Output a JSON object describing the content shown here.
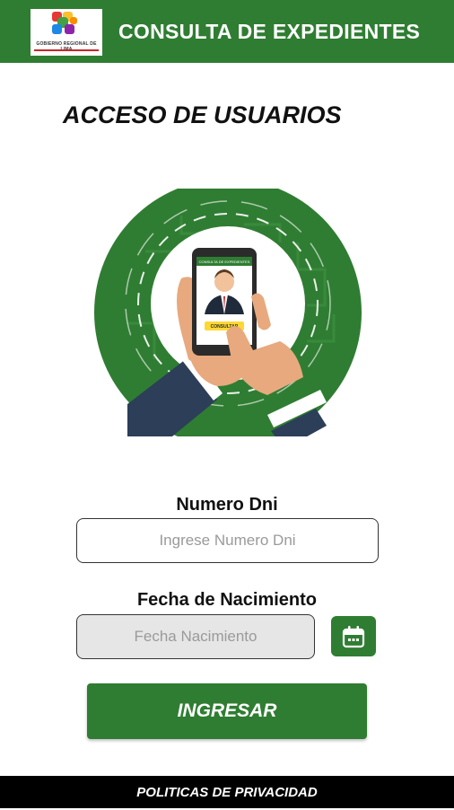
{
  "header": {
    "title": "CONSULTA DE EXPEDIENTES",
    "logo_caption": "GOBIERNO REGIONAL DE LIMA",
    "color": "#2f7d32"
  },
  "page_title": "ACCESO DE USUARIOS",
  "hero": {
    "phone_header_text": "CONSULTA DE EXPEDIENTES",
    "phone_button_text": "CONSULTAR"
  },
  "form": {
    "dni_label": "Numero Dni",
    "dni_placeholder": "Ingrese Numero Dni",
    "fecha_label": "Fecha de Nacimiento",
    "fecha_placeholder": "Fecha Nacimiento",
    "calendar_icon": "calendar-icon",
    "submit_label": "INGRESAR"
  },
  "footer": {
    "privacy_label": "POLITICAS DE PRIVACIDAD"
  },
  "colors": {
    "primary_green": "#2f7d32",
    "footer_bg": "#000000",
    "input_disabled_bg": "#e6e6e6"
  }
}
